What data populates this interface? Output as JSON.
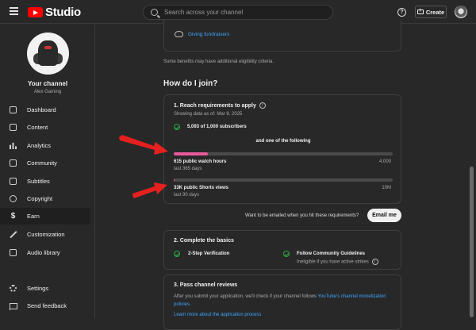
{
  "app": {
    "name": "Studio"
  },
  "search": {
    "placeholder": "Search across your channel"
  },
  "header": {
    "create_label": "Create",
    "help_label": "?"
  },
  "channel": {
    "title": "Your channel",
    "name": "Alex Gaming"
  },
  "sidebar": {
    "items": [
      {
        "label": "Dashboard",
        "icon": "dashboard-icon"
      },
      {
        "label": "Content",
        "icon": "content-icon"
      },
      {
        "label": "Analytics",
        "icon": "analytics-icon"
      },
      {
        "label": "Community",
        "icon": "community-icon"
      },
      {
        "label": "Subtitles",
        "icon": "subtitles-icon"
      },
      {
        "label": "Copyright",
        "icon": "copyright-icon"
      },
      {
        "label": "Earn",
        "icon": "earn-icon",
        "active": true
      },
      {
        "label": "Customization",
        "icon": "customization-icon"
      },
      {
        "label": "Audio library",
        "icon": "audio-library-icon"
      },
      {
        "label": "Settings",
        "icon": "settings-icon"
      },
      {
        "label": "Send feedback",
        "icon": "feedback-icon"
      }
    ]
  },
  "benefits": {
    "fundraisers_label": "Giving fundraisers",
    "note": "Some benefits may have additional eligibility criteria."
  },
  "join": {
    "heading": "How do I join?",
    "step1": {
      "title": "1. Reach requirements to apply",
      "data_as_of": "Showing data as of: Mar 8, 2025",
      "subscribers": "5,093 of 1,000 subscribers",
      "one_of": "and one of the following",
      "watch_hours": {
        "label": "615 public watch hours",
        "period": "last 365 days",
        "target": "4,000",
        "progress": 0.154
      },
      "shorts_views": {
        "label": "33K public Shorts views",
        "period": "last 90 days",
        "target": "10M",
        "progress": 0.003
      }
    },
    "email": {
      "question": "Want to be emailed when you hit these requirements?",
      "button": "Email me"
    },
    "step2": {
      "title": "2. Complete the basics",
      "verification": "2-Step Verification",
      "guidelines": "Follow Community Guidelines",
      "guidelines_note": "Ineligible if you have active strikes"
    },
    "step3": {
      "title": "3. Pass channel reviews",
      "text": "After you submit your application, we'll check if your channel follows ",
      "policy_link": "YouTube's channel monetization policies.",
      "learn_more": "Learn more about the application process"
    }
  },
  "colors": {
    "accent": "#3ea6ff",
    "progress": "#e85a9c",
    "check": "#2ba640",
    "annotation": "#e5201e"
  }
}
